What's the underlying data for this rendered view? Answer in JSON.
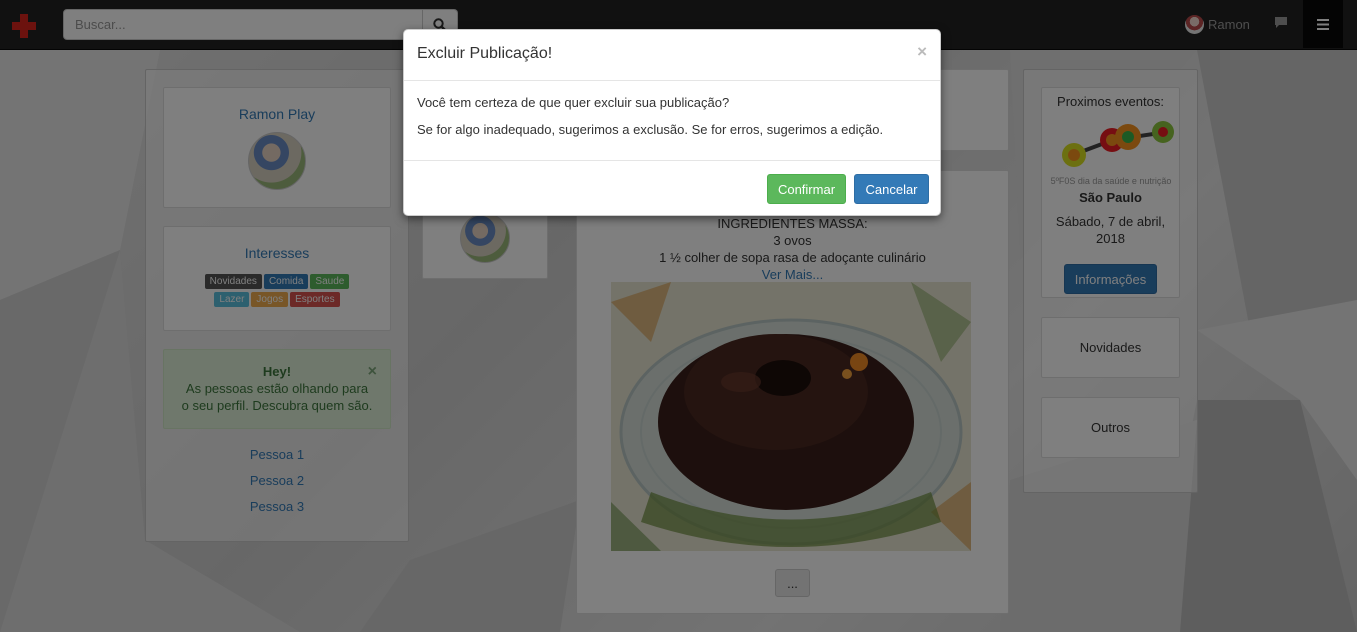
{
  "navbar": {
    "search_placeholder": "Buscar...",
    "user_name": "Ramon"
  },
  "profile": {
    "name": "Ramon Play"
  },
  "interests": {
    "title": "Interesses",
    "tags": [
      {
        "label": "Novidades",
        "color": "#555555"
      },
      {
        "label": "Comida",
        "color": "#337ab7"
      },
      {
        "label": "Saude",
        "color": "#5cb85c"
      },
      {
        "label": "Lazer",
        "color": "#5bc0de"
      },
      {
        "label": "Jogos",
        "color": "#f0ad4e"
      },
      {
        "label": "Esportes",
        "color": "#d9534f"
      }
    ]
  },
  "alert": {
    "title": "Hey!",
    "line1": "As pessoas estão olhando para",
    "line2": "o seu perfil. Descubra quem são."
  },
  "people": [
    "Pessoa 1",
    "Pessoa 2",
    "Pessoa 3"
  ],
  "post": {
    "line1": "INGREDIENTES MASSA:",
    "line2": "3 ovos",
    "line3": "1 ½ colher de sopa rasa de adoçante culinário",
    "more": "Ver Mais...",
    "more_button": "..."
  },
  "events": {
    "title": "Proximos eventos:",
    "banner_text": "5ºF0S dia da saúde e nutrição",
    "city": "São Paulo",
    "date": "Sábado, 7 de abril, 2018",
    "button": "Informações"
  },
  "side_links": [
    "Novidades",
    "Outros"
  ],
  "modal": {
    "title": "Excluir Publicação!",
    "close": "×",
    "body_line1": "Você tem certeza de que quer excluir sua publicação?",
    "body_line2": "Se for algo inadequado, sugerimos a exclusão. Se for erros, sugerimos a edição.",
    "confirm": "Confirmar",
    "cancel": "Cancelar"
  }
}
